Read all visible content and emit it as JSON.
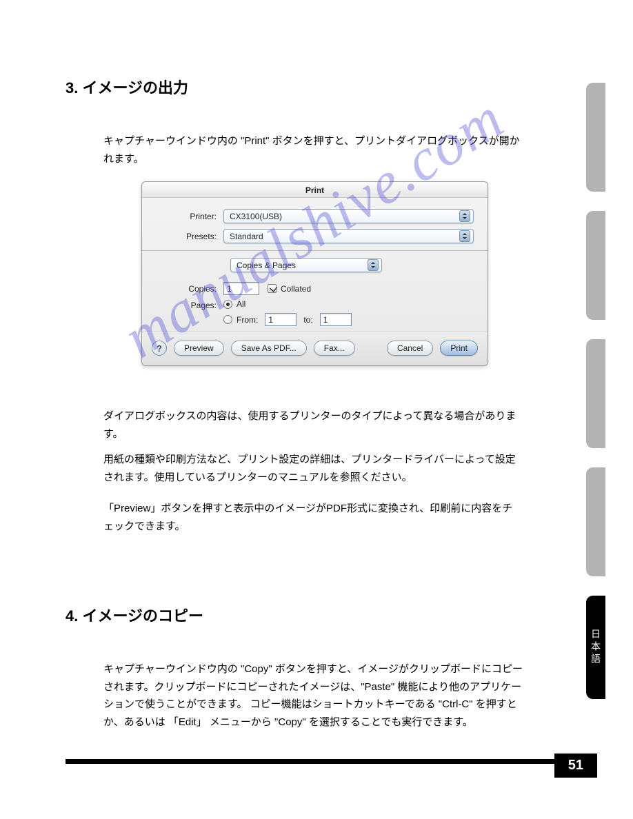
{
  "section3": {
    "title": "3. イメージの出力",
    "intro": "キャプチャーウインドウ内の \"Print\" ボタンを押すと、プリントダイアログボックスが開かれます。",
    "note1": "ダイアログボックスの内容は、使用するプリンターのタイプによって異なる場合があります。",
    "note2": "用紙の種類や印刷方法など、プリント設定の詳細は、プリンタードライバーによって設定されます。使用しているプリンターのマニュアルを参照ください。",
    "note3": "「Preview」ボタンを押すと表示中のイメージがPDF形式に変換され、印刷前に内容をチェックできます。"
  },
  "section4": {
    "title": "4. イメージのコピー",
    "body": "キャプチャーウインドウ内の \"Copy\" ボタンを押すと、イメージがクリップボードにコピーされます。クリップボードにコピーされたイメージは、\"Paste\" 機能により他のアプリケーションで使うことができます。 コピー機能はショートカットキーである \"Ctrl-C\" を押すとか、あるいは 「Edit」 メニューから \"Copy\" を選択することでも実行できます。"
  },
  "dialog": {
    "title": "Print",
    "printer_label": "Printer:",
    "printer_value": "CX3100(USB)",
    "presets_label": "Presets:",
    "presets_value": "Standard",
    "section_value": "Copies & Pages",
    "copies_label": "Copies:",
    "copies_value": "1",
    "collated_label": "Collated",
    "pages_label": "Pages:",
    "pages_all": "All",
    "pages_from": "From:",
    "pages_from_value": "1",
    "pages_to": "to:",
    "pages_to_value": "1",
    "help": "?",
    "preview": "Preview",
    "saveas": "Save As PDF...",
    "fax": "Fax...",
    "cancel": "Cancel",
    "print": "Print"
  },
  "side_tab_active": "日本語",
  "watermark": "manualshive.com",
  "page_number": "51"
}
